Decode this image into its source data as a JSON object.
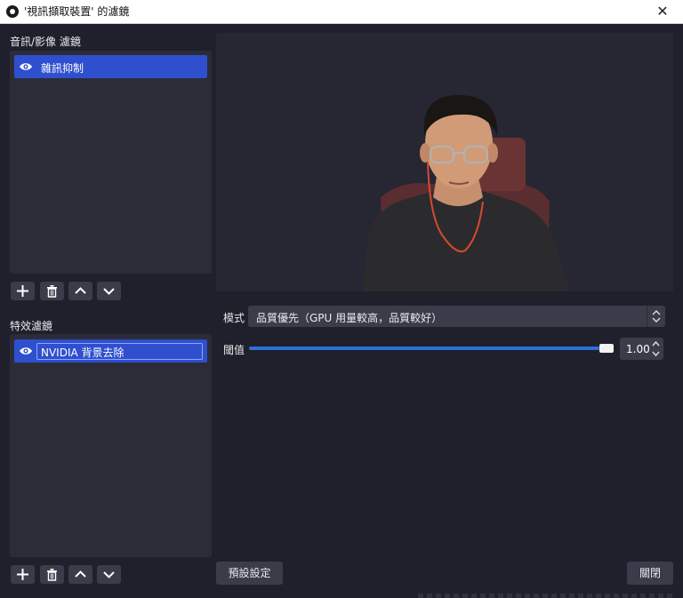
{
  "window": {
    "title": "'視訊擷取裝置' 的濾鏡",
    "close_glyph": "✕"
  },
  "audio_video_filters": {
    "label": "音訊/影像 濾鏡",
    "items": [
      {
        "label": "雜訊抑制",
        "visible_icon": "eye-icon"
      }
    ]
  },
  "effect_filters": {
    "label": "特效濾鏡",
    "items": [
      {
        "label": "NVIDIA 背景去除",
        "visible_icon": "eye-icon"
      }
    ]
  },
  "toolbar_icons": [
    "plus-icon",
    "trash-icon",
    "chevron-up-icon",
    "chevron-down-icon"
  ],
  "properties": {
    "mode": {
      "label": "模式",
      "value": "品質優先（GPU 用量較高，品質較好）"
    },
    "threshold": {
      "label": "閾值",
      "value": "1.00",
      "level": 1.0
    }
  },
  "buttons": {
    "defaults": "預設設定",
    "close": "關閉"
  },
  "colors": {
    "accent": "#2f4fcf",
    "slider": "#2e6fd6",
    "panel": "#2b2c38",
    "background": "#1f202b"
  }
}
